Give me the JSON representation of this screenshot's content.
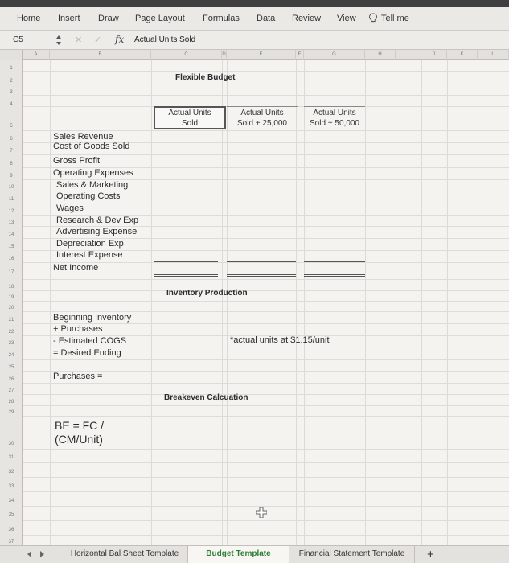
{
  "ribbon": {
    "tabs": [
      "Home",
      "Insert",
      "Draw",
      "Page Layout",
      "Formulas",
      "Data",
      "Review",
      "View"
    ],
    "tell_me": "Tell me"
  },
  "formula_bar": {
    "name_box": "C5",
    "cancel": "✕",
    "enter": "✓",
    "fx": "fx",
    "value": "Actual Units Sold"
  },
  "columns": [
    "A",
    "B",
    "C",
    "D",
    "E",
    "F",
    "G",
    "H",
    "I",
    "J",
    "K",
    "L"
  ],
  "rows": [
    "1",
    "2",
    "3",
    "4",
    "5",
    "6",
    "7",
    "8",
    "9",
    "10",
    "11",
    "12",
    "13",
    "14",
    "15",
    "16",
    "17",
    "18",
    "19",
    "20",
    "21",
    "22",
    "23",
    "24",
    "25",
    "26",
    "27",
    "28",
    "29",
    "30",
    "31",
    "32",
    "33",
    "34",
    "35",
    "36",
    "37"
  ],
  "flexible_budget": {
    "title": "Flexible Budget",
    "headers": [
      {
        "line1": "Actual Units",
        "line2": "Sold"
      },
      {
        "line1": "Actual Units",
        "line2": "Sold + 25,000"
      },
      {
        "line1": "Actual Units",
        "line2": "Sold + 50,000"
      }
    ],
    "items": [
      "Sales Revenue",
      "Cost of Goods Sold",
      "Gross Profit",
      "Operating Expenses",
      "Sales & Marketing",
      "Operating Costs",
      "Wages",
      "Research & Dev Exp",
      "Advertising Expense",
      "Depreciation Exp",
      "Interest Expense",
      "Net Income"
    ]
  },
  "inventory": {
    "title": "Inventory Production",
    "items": [
      "Beginning Inventory",
      "+ Purchases",
      "- Estimated COGS",
      "= Desired Ending"
    ],
    "note": "*actual units at $1.15/unit",
    "purchases": "Purchases ="
  },
  "breakeven": {
    "title": "Breakeven Calcuation",
    "formula_line1": "BE = FC /",
    "formula_line2": "(CM/Unit)"
  },
  "sheet_tabs": [
    "Horizontal Bal Sheet Template",
    "Budget Template",
    "Financial Statement Template"
  ],
  "active_sheet": "Budget Template",
  "add_sheet": "+"
}
